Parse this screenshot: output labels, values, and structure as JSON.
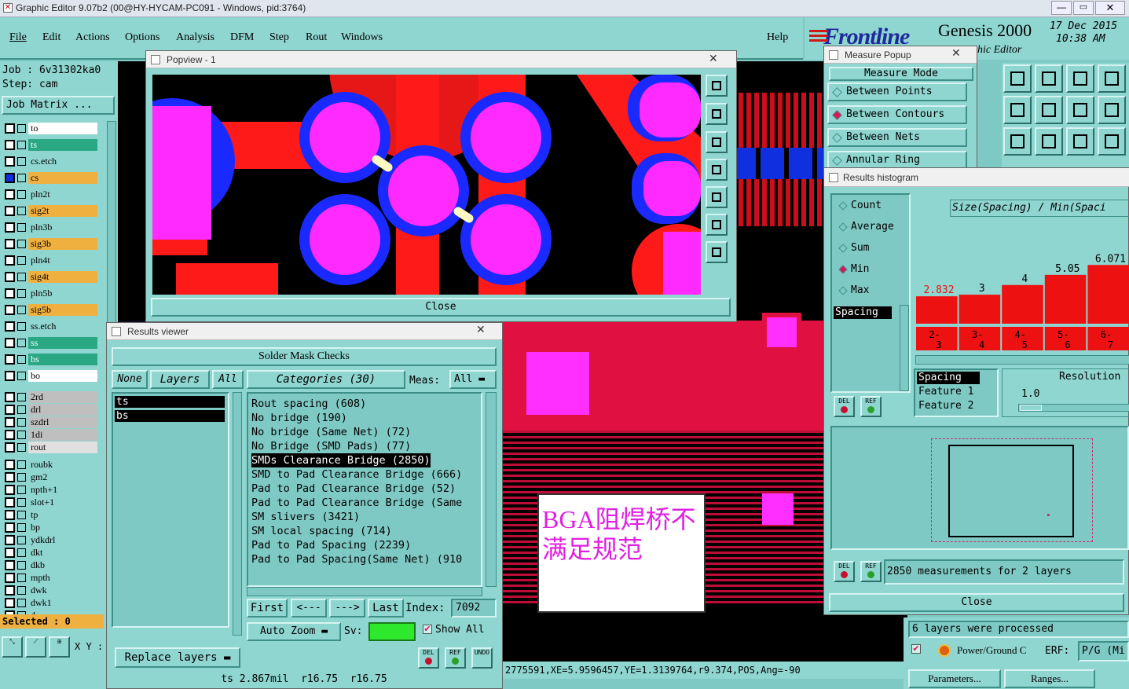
{
  "app": {
    "title": "Graphic Editor 9.07b2 (00@HY-HYCAM-PC091 - Windows, pid:3764)",
    "brand": "Frontline",
    "product": "Genesis 2000",
    "subtitle": "hic Editor",
    "date": "17 Dec 2015",
    "time": "10:38 AM"
  },
  "menu": {
    "items": [
      "File",
      "Edit",
      "Actions",
      "Options",
      "Analysis",
      "DFM",
      "Step",
      "Rout",
      "Windows"
    ],
    "help": "Help"
  },
  "job": {
    "job_label": "Job : 6v31302ka0",
    "step_label": "Step: cam",
    "matrix_button": "Job Matrix ..."
  },
  "layers": [
    {
      "name": "to",
      "color": "#ffffff"
    },
    {
      "name": "ts",
      "color": "#2aa884"
    },
    {
      "name": "cs.etch",
      "color": "#8fd5d0"
    },
    {
      "name": "cs",
      "color": "#f0b040"
    },
    {
      "name": "pln2t",
      "color": "#8fd5d0"
    },
    {
      "name": "sig2t",
      "color": "#f0b040"
    },
    {
      "name": "pln3b",
      "color": "#8fd5d0"
    },
    {
      "name": "sig3b",
      "color": "#f0b040"
    },
    {
      "name": "pln4t",
      "color": "#8fd5d0"
    },
    {
      "name": "sig4t",
      "color": "#f0b040"
    },
    {
      "name": "pln5b",
      "color": "#8fd5d0"
    },
    {
      "name": "sig5b",
      "color": "#f0b040"
    },
    {
      "name": "ss.etch",
      "color": "#8fd5d0"
    },
    {
      "name": "ss",
      "color": "#2aa884"
    },
    {
      "name": "bs",
      "color": "#2aa884"
    },
    {
      "name": "bo",
      "color": "#ffffff"
    },
    {
      "name": "2rd",
      "color": "#bfbfbf"
    },
    {
      "name": "drl",
      "color": "#bfbfbf"
    },
    {
      "name": "szdrl",
      "color": "#bfbfbf"
    },
    {
      "name": "1di",
      "color": "#bfbfbf"
    },
    {
      "name": "rout",
      "color": "#e0e0e0"
    },
    {
      "name": "roubk",
      "color": "#8fd5d0"
    },
    {
      "name": "gm2",
      "color": "#8fd5d0"
    },
    {
      "name": "npth+1",
      "color": "#8fd5d0"
    },
    {
      "name": "slot+1",
      "color": "#8fd5d0"
    },
    {
      "name": "tp",
      "color": "#8fd5d0"
    },
    {
      "name": "bp",
      "color": "#8fd5d0"
    },
    {
      "name": "ydkdrl",
      "color": "#8fd5d0"
    },
    {
      "name": "dkt",
      "color": "#8fd5d0"
    },
    {
      "name": "dkb",
      "color": "#8fd5d0"
    },
    {
      "name": "mpth",
      "color": "#8fd5d0"
    },
    {
      "name": "dwk",
      "color": "#8fd5d0"
    },
    {
      "name": "dwk1",
      "color": "#8fd5d0"
    },
    {
      "name": "d",
      "color": "#8fd5d0"
    }
  ],
  "selected_label": "Selected : 0",
  "xy_label": "X Y :",
  "popview": {
    "title": "Popview - 1",
    "close": "Close"
  },
  "measure": {
    "title": "Measure Popup",
    "header": "Measure Mode",
    "modes": [
      {
        "label": "Between Points",
        "on": false
      },
      {
        "label": "Between Contours",
        "on": true
      },
      {
        "label": "Between Nets",
        "on": false
      },
      {
        "label": "Annular Ring",
        "on": false
      }
    ]
  },
  "histogram": {
    "title": "Results histogram",
    "options": [
      {
        "label": "Count",
        "on": false
      },
      {
        "label": "Average",
        "on": false
      },
      {
        "label": "Sum",
        "on": false
      },
      {
        "label": "Min",
        "on": true
      },
      {
        "label": "Max",
        "on": false
      }
    ],
    "list_item": "Spacing",
    "axis_title": "Size(Spacing) / Min(Spaci",
    "bins_label": [
      "2-3",
      "3-4",
      "4-5",
      "5-6",
      "6-7"
    ],
    "bin_top": [
      "2-",
      "3-",
      "4-",
      "5-",
      "6-"
    ],
    "bin_bottom": [
      "3",
      "4",
      "5",
      "6",
      "7"
    ],
    "value_labels": [
      "2.832",
      "3",
      "4",
      "5.05",
      "6.071"
    ],
    "values": [
      2.832,
      3,
      4,
      5.05,
      6.071
    ],
    "spacing_lines": [
      "Spacing",
      "Feature 1",
      "Feature 2"
    ],
    "resolution_label": "Resolution",
    "resolution_value": "1.0",
    "measurements": "2850 measurements for 2 layers",
    "close": "Close",
    "processed": "6 layers were processed",
    "power_label": "Power/Ground C",
    "erf_label": "ERF:",
    "pg_value": "P/G (Mi",
    "parameters": "Parameters...",
    "ranges": "Ranges..."
  },
  "results": {
    "title": "Results viewer",
    "heading": "Solder Mask Checks",
    "none_btn": "None",
    "layers_btn": "Layers",
    "all_btn": "All",
    "categories_btn": "Categories (30)",
    "meas_label": "Meas:",
    "meas_value": "All",
    "layer_list": [
      "ts",
      "bs"
    ],
    "categories": [
      "Rout spacing (608)",
      "No bridge (190)",
      "No bridge (Same Net) (72)",
      "No Bridge (SMD Pads) (77)",
      "SMDs Clearance Bridge (2850)",
      "SMD to Pad Clearance Bridge (666)",
      "Pad to Pad Clearance Bridge (52)",
      "Pad to Pad Clearance Bridge (Same",
      "SM slivers (3421)",
      "SM local spacing (714)",
      "Pad to Pad Spacing (2239)",
      "Pad to Pad Spacing(Same Net) (910"
    ],
    "selected_index": 4,
    "first": "First",
    "prev": "<---",
    "next": "--->",
    "last": "Last",
    "index_label": "Index:",
    "index_value": "7092",
    "auto_zoom": "Auto Zoom",
    "sv_label": "Sv:",
    "show_all": "Show All",
    "replace_layers": "Replace layers",
    "status": "ts 2.867mil  r16.75  r16.75",
    "del": "DEL",
    "ref": "REF",
    "undo": "UNDO"
  },
  "annotation": {
    "line1": "BGA阻焊桥不",
    "line2": "满足规范"
  },
  "coord_status": "2775591,XE=5.9596457,YE=1.3139764,r9.374,POS,Ang=-90"
}
